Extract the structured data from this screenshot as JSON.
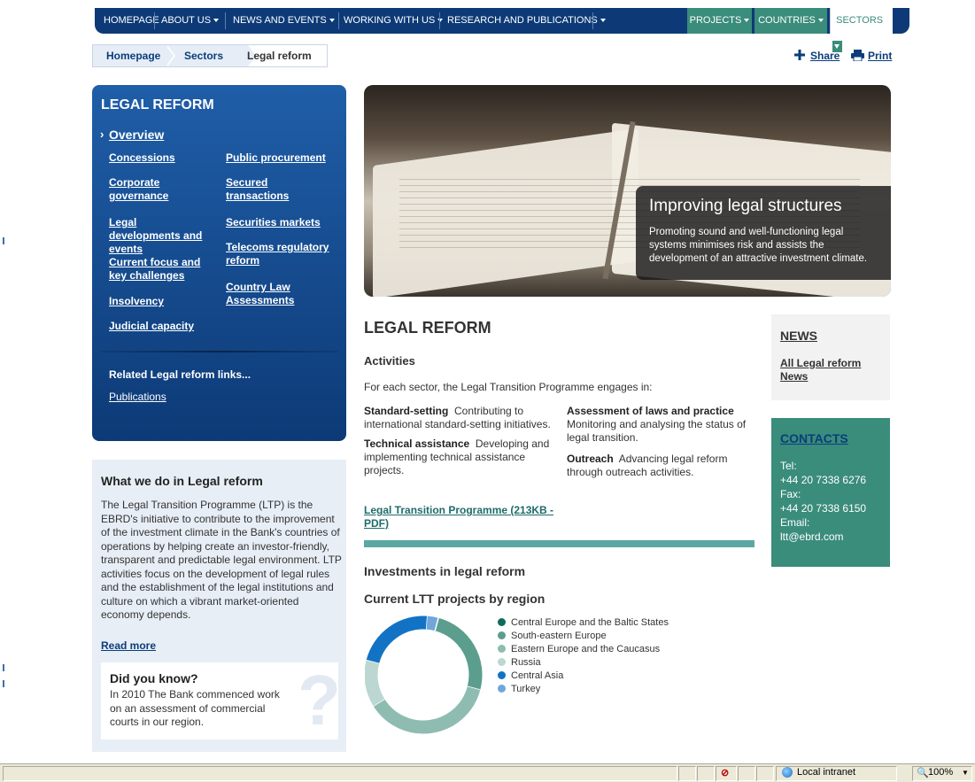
{
  "top_nav": {
    "items": [
      "HOMEPAGE",
      "ABOUT US",
      "NEWS AND EVENTS",
      "WORKING WITH US",
      "RESEARCH AND PUBLICATIONS"
    ],
    "right_items": [
      "PROJECTS",
      "COUNTRIES",
      "SECTORS"
    ]
  },
  "breadcrumb": [
    "Homepage",
    "Sectors",
    "Legal reform"
  ],
  "actions": {
    "share": "Share",
    "print": "Print"
  },
  "sidebar": {
    "title": "LEGAL REFORM",
    "overview": "Overview",
    "links_left": [
      "Concessions",
      "Corporate governance",
      "Legal developments and events",
      "Current focus and key challenges",
      "Insolvency",
      "Judicial capacity"
    ],
    "links_right": [
      "Public procurement",
      "Secured transactions",
      "Securities markets",
      "Telecoms regulatory reform",
      "Country Law Assessments"
    ],
    "related": "Related Legal reform links...",
    "publications": "Publications"
  },
  "what_we_do": {
    "title": "What we do in Legal reform",
    "body": "The Legal Transition Programme (LTP) is the EBRD's initiative to contribute to the improvement of the investment climate in the Bank's countries of operations by helping create an investor-friendly, transparent and predictable legal environment. LTP activities focus on the development of legal rules and the establishment of the legal institutions and culture on which a vibrant market-oriented economy depends.",
    "read_more": "Read more",
    "did_you_know_title": "Did you know?",
    "did_you_know_text": "In 2010 The Bank commenced work on an assessment of commercial courts in our region."
  },
  "hero": {
    "caption_title": "Improving legal structures",
    "caption_text": "Promoting sound and well-functioning legal systems minimises risk and assists the development of an attractive investment climate."
  },
  "main": {
    "title": "LEGAL REFORM",
    "activities": "Activities",
    "intro": "For each sector, the Legal Transition Programme engages in:",
    "items": [
      {
        "bold": "Standard-setting",
        "text": "Contributing to international standard-setting initiatives."
      },
      {
        "bold": "Technical assistance",
        "text": "Developing and implementing technical assistance projects."
      },
      {
        "bold": "Assessment of laws and practice",
        "text": "Monitoring and analysing the status of legal transition."
      },
      {
        "bold": "Outreach",
        "text": "Advancing legal reform through outreach activities."
      }
    ],
    "ltp_link": "Legal Transition Programme (213KB - PDF)",
    "investments": "Investments in legal reform",
    "chart_title": "Current LTT projects by region"
  },
  "chart_data": {
    "type": "pie",
    "title": "Current LTT projects by region",
    "categories": [
      "Central Europe and the Baltic States",
      "South-eastern Europe",
      "Eastern Europe and the Caucasus",
      "Russia",
      "Central Asia",
      "Turkey"
    ],
    "values": [
      0,
      25,
      37,
      13,
      22,
      3
    ],
    "colors": [
      "#0f6b5a",
      "#5b9e8e",
      "#8fbcb0",
      "#bcd7d1",
      "#1273c4",
      "#6fa7db"
    ],
    "legend_position": "right"
  },
  "news": {
    "title": "NEWS",
    "link": "All Legal reform News"
  },
  "contacts": {
    "title": "CONTACTS",
    "lines": [
      "Tel:",
      "+44 20 7338 6276",
      "Fax:",
      "+44 20 7338 6150",
      "Email:",
      "ltt@ebrd.com"
    ]
  },
  "status_bar": {
    "zone": "Local intranet",
    "zoom": "100%"
  }
}
